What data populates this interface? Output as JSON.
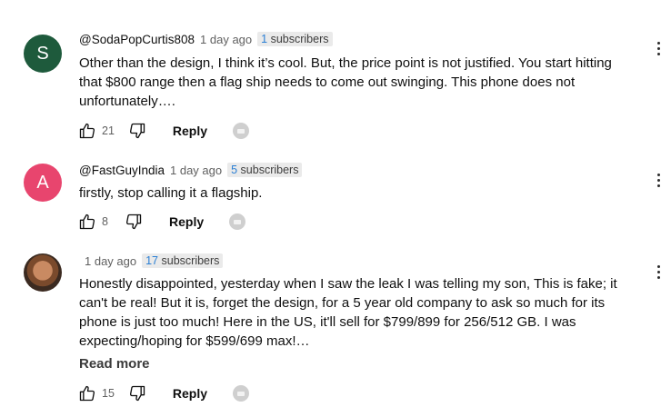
{
  "comments": [
    {
      "avatar_letter": "S",
      "author": "@SodaPopCurtis808",
      "time": "1 day ago",
      "subs_count": "1",
      "subs_label": "subscribers",
      "text_lines": [
        "Other than the design, I think it’s cool. But, the price point is not justified. You start hitting",
        "that $800 range then a flag ship needs to come out swinging. This phone does not",
        "unfortunately…."
      ],
      "likes": "21",
      "reply": "Reply"
    },
    {
      "avatar_letter": "A",
      "author": "@FastGuyIndia",
      "time": "1 day ago",
      "subs_count": "5",
      "subs_label": "subscribers",
      "text_lines": [
        "firstly, stop calling it a flagship."
      ],
      "likes": "8",
      "reply": "Reply"
    },
    {
      "author": "",
      "time": "1 day ago",
      "subs_count": "17",
      "subs_label": "subscribers",
      "text_lines": [
        "Honestly disappointed, yesterday when I saw the leak I was telling my son, This is fake; it",
        "can't be real! But it is, forget the design, for a 5 year old company to ask so much for its",
        "phone is just too much! Here in the US, it'll sell for $799/899 for 256/512 GB. I was",
        "expecting/hoping for $599/699 max!…"
      ],
      "read_more": "Read more",
      "likes": "15",
      "reply": "Reply"
    }
  ]
}
